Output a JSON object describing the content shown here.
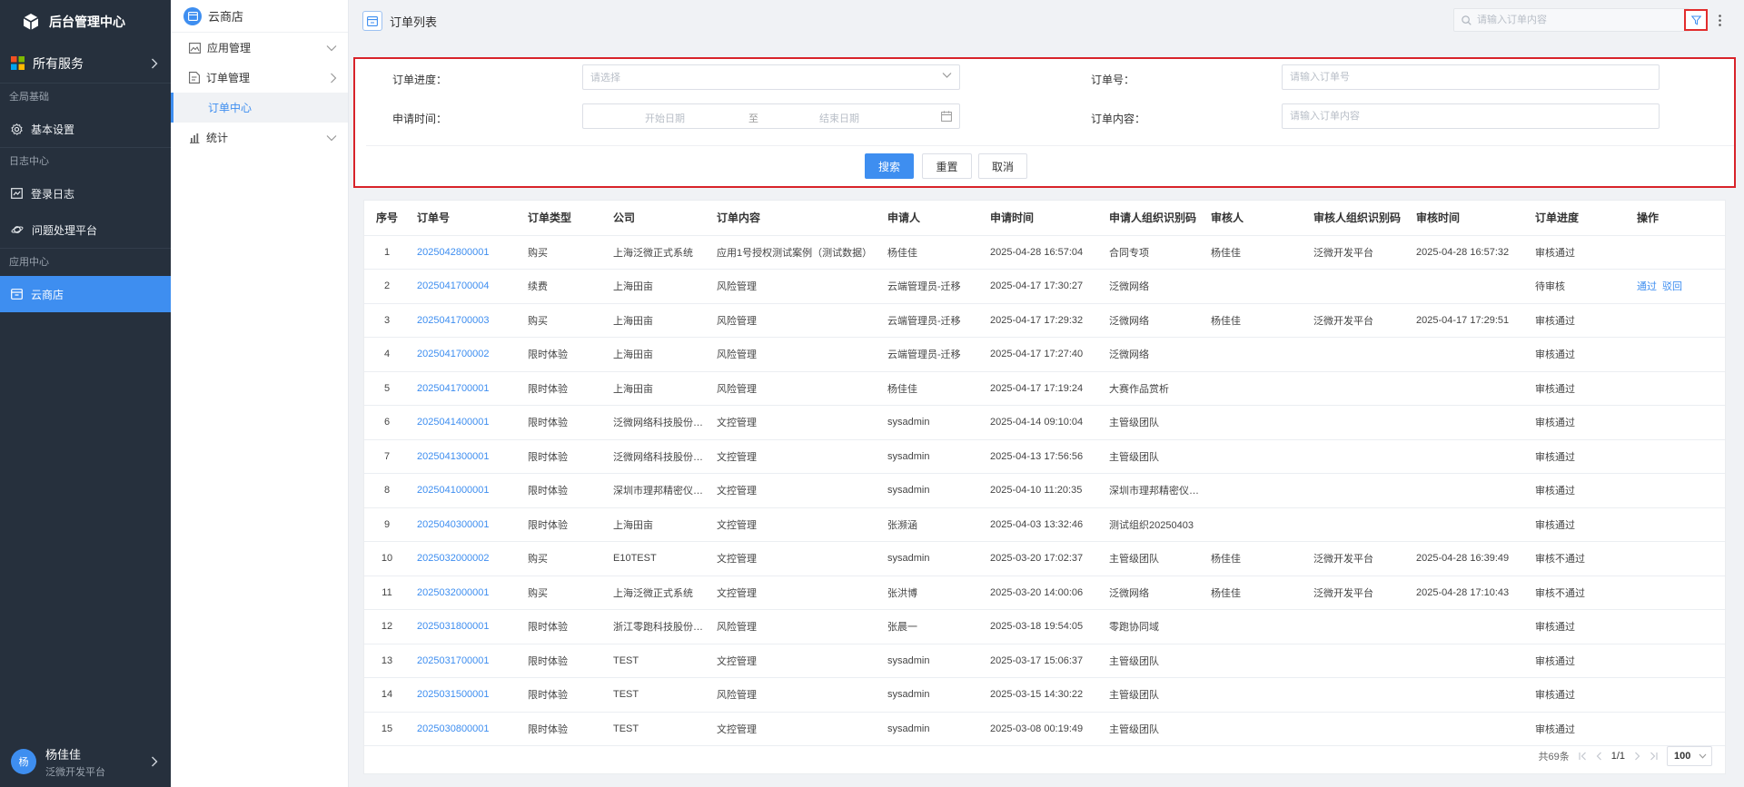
{
  "sidebar": {
    "logo_title": "后台管理中心",
    "all_services": "所有服务",
    "group_base": "全局基础",
    "item_basic_settings": "基本设置",
    "group_logs": "日志中心",
    "item_login_log": "登录日志",
    "item_issue_platform": "问题处理平台",
    "group_apps": "应用中心",
    "item_cloud_store": "云商店",
    "user_avatar": "杨",
    "user_name": "杨佳佳",
    "user_org": "泛微开发平台"
  },
  "submenu": {
    "title": "云商店",
    "app_management": "应用管理",
    "order_management": "订单管理",
    "order_center": "订单中心",
    "statistics": "统计"
  },
  "header": {
    "title": "订单列表",
    "search_placeholder": "请输入订单内容"
  },
  "filter": {
    "progress_label": "订单进度：",
    "progress_placeholder": "请选择",
    "order_no_label": "订单号：",
    "order_no_placeholder": "请输入订单号",
    "apply_time_label": "申请时间：",
    "start_date": "开始日期",
    "to": "至",
    "end_date": "结束日期",
    "content_label": "订单内容：",
    "content_placeholder": "请输入订单内容",
    "search_btn": "搜索",
    "reset_btn": "重置",
    "cancel_btn": "取消"
  },
  "table": {
    "headers": [
      "序号",
      "订单号",
      "订单类型",
      "公司",
      "订单内容",
      "申请人",
      "申请时间",
      "申请人组织识别码",
      "审核人",
      "审核人组织识别码",
      "审核时间",
      "订单进度",
      "操作"
    ],
    "rows": [
      [
        "1",
        "2025042800001",
        "购买",
        "上海泛微正式系统",
        "应用1号授权测试案例（测试数据）",
        "杨佳佳",
        "2025-04-28 16:57:04",
        "合同专项",
        "杨佳佳",
        "泛微开发平台",
        "2025-04-28 16:57:32",
        "审核通过",
        ""
      ],
      [
        "2",
        "2025041700004",
        "续费",
        "上海田亩",
        "风险管理",
        "云端管理员-迁移",
        "2025-04-17 17:30:27",
        "泛微网络",
        "",
        "",
        "",
        "待审核",
        "通过 驳回"
      ],
      [
        "3",
        "2025041700003",
        "购买",
        "上海田亩",
        "风险管理",
        "云端管理员-迁移",
        "2025-04-17 17:29:32",
        "泛微网络",
        "杨佳佳",
        "泛微开发平台",
        "2025-04-17 17:29:51",
        "审核通过",
        ""
      ],
      [
        "4",
        "2025041700002",
        "限时体验",
        "上海田亩",
        "风险管理",
        "云端管理员-迁移",
        "2025-04-17 17:27:40",
        "泛微网络",
        "",
        "",
        "",
        "审核通过",
        ""
      ],
      [
        "5",
        "2025041700001",
        "限时体验",
        "上海田亩",
        "风险管理",
        "杨佳佳",
        "2025-04-17 17:19:24",
        "大赛作品赏析",
        "",
        "",
        "",
        "审核通过",
        ""
      ],
      [
        "6",
        "2025041400001",
        "限时体验",
        "泛微网络科技股份有限公司",
        "文控管理",
        "sysadmin",
        "2025-04-14 09:10:04",
        "主管级团队",
        "",
        "",
        "",
        "审核通过",
        ""
      ],
      [
        "7",
        "2025041300001",
        "限时体验",
        "泛微网络科技股份有限公司",
        "文控管理",
        "sysadmin",
        "2025-04-13 17:56:56",
        "主管级团队",
        "",
        "",
        "",
        "审核通过",
        ""
      ],
      [
        "8",
        "2025041000001",
        "限时体验",
        "深圳市理邦精密仪器股份有限公司",
        "文控管理",
        "sysadmin",
        "2025-04-10 11:20:35",
        "深圳市理邦精密仪器股份有限公司",
        "",
        "",
        "",
        "审核通过",
        ""
      ],
      [
        "9",
        "2025040300001",
        "限时体验",
        "上海田亩",
        "文控管理",
        "张濒涵",
        "2025-04-03 13:32:46",
        "测试组织20250403",
        "",
        "",
        "",
        "审核通过",
        ""
      ],
      [
        "10",
        "2025032000002",
        "购买",
        "E10TEST",
        "文控管理",
        "sysadmin",
        "2025-03-20 17:02:37",
        "主管级团队",
        "杨佳佳",
        "泛微开发平台",
        "2025-04-28 16:39:49",
        "审核不通过",
        ""
      ],
      [
        "11",
        "2025032000001",
        "购买",
        "上海泛微正式系统",
        "文控管理",
        "张洪博",
        "2025-03-20 14:00:06",
        "泛微网络",
        "杨佳佳",
        "泛微开发平台",
        "2025-04-28 17:10:43",
        "审核不通过",
        ""
      ],
      [
        "12",
        "2025031800001",
        "限时体验",
        "浙江零跑科技股份有限公司",
        "风险管理",
        "张晨一",
        "2025-03-18 19:54:05",
        "零跑协同域",
        "",
        "",
        "",
        "审核通过",
        ""
      ],
      [
        "13",
        "2025031700001",
        "限时体验",
        "TEST",
        "文控管理",
        "sysadmin",
        "2025-03-17 15:06:37",
        "主管级团队",
        "",
        "",
        "",
        "审核通过",
        ""
      ],
      [
        "14",
        "2025031500001",
        "限时体验",
        "TEST",
        "风险管理",
        "sysadmin",
        "2025-03-15 14:30:22",
        "主管级团队",
        "",
        "",
        "",
        "审核通过",
        ""
      ],
      [
        "15",
        "2025030800001",
        "限时体验",
        "TEST",
        "文控管理",
        "sysadmin",
        "2025-03-08 00:19:49",
        "主管级团队",
        "",
        "",
        "",
        "审核通过",
        ""
      ]
    ]
  },
  "pagination": {
    "total": "共69条",
    "page": "1/1",
    "page_size": "100"
  },
  "colors": {
    "sidebar_bg": "#26303d",
    "accent": "#3e8ef0",
    "highlight_border": "#d8232a"
  },
  "icons": [
    "cube-logo-icon",
    "grid-apps-icon",
    "gear-icon",
    "log-icon",
    "planet-icon",
    "store-icon",
    "search-icon",
    "filter-icon",
    "more-vertical-icon",
    "calendar-icon",
    "chevron-down-icon",
    "chevron-right-icon",
    "first-page-icon",
    "prev-page-icon",
    "next-page-icon",
    "last-page-icon"
  ]
}
